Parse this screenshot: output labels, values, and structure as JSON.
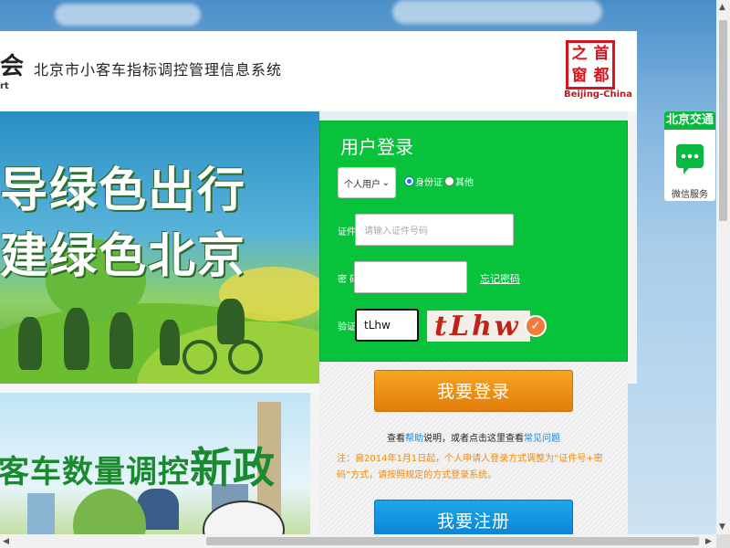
{
  "header": {
    "logo_char": "会",
    "logo_sub": "rt",
    "site_title": "北京市小客车指标调控管理信息系统",
    "seal_chars": [
      "之",
      "首",
      "窗",
      "都"
    ],
    "seal_caption": "Beijing-China"
  },
  "banners": {
    "top_lines": [
      "导绿色出行",
      "建绿色北京"
    ],
    "second_headline": "客车数量调控",
    "second_headline_big": "新政"
  },
  "login": {
    "title": "用户登录",
    "usertype_selected": "个人用户",
    "radio_options": [
      {
        "label": "身份证",
        "checked": true
      },
      {
        "label": "其他",
        "checked": false
      }
    ],
    "id_label": "证件号码",
    "id_placeholder": "请输入证件号码",
    "password_label": "密 码",
    "password_value": "",
    "forgot_link": "忘记密码",
    "captcha_label": "验证码",
    "captcha_value": "tLhw",
    "captcha_image_text": "tLhw",
    "login_button": "我要登录",
    "help_prefix": "查看",
    "help_link1": "帮助",
    "help_middle": "说明，或者点击这里查看",
    "help_link2": "常见问题",
    "help_suffix": "",
    "notice": "注：自2014年1月1日起，个人申请人登录方式调整为“证件号+密码”方式，请按照规定的方式登录系统。",
    "register_button": "我要注册"
  },
  "widget": {
    "header": "北京交通",
    "label": "微信服务"
  },
  "colors": {
    "login_green": "#07c23a",
    "login_button": "#e27c0b",
    "register_button": "#0a7fd0",
    "notice_orange": "#f08a10"
  }
}
